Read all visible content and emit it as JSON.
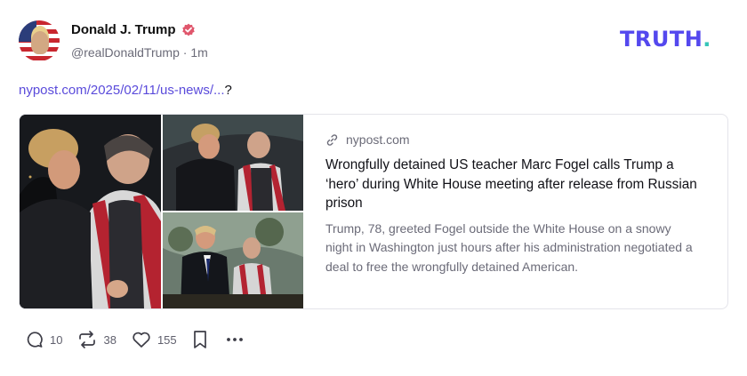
{
  "post": {
    "author_name": "Donald J. Trump",
    "handle": "@realDonaldTrump",
    "separator": "·",
    "time": "1m",
    "link_text": "nypost.com/2025/02/11/us-news/...",
    "link_suffix": "?"
  },
  "brand": {
    "logo_text": "TRUTH",
    "logo_dot": ".",
    "logo_color": "#5448ee",
    "dot_color": "#36c5b8",
    "verified_color": "#e0566c"
  },
  "card": {
    "domain": "nypost.com",
    "title": "Wrongfully detained US teacher Marc Fogel calls Trump a ‘hero’ during White House meeting after release from Russian prison",
    "description": "Trump, 78, greeted Fogel outside the White House on a snowy night in Washington just hours after his administration negotiated a deal to free the wrongfully detained American."
  },
  "actions": {
    "replies": "10",
    "retruths": "38",
    "likes": "155"
  },
  "icons": [
    "verified-icon",
    "link-icon",
    "reply-icon",
    "retruth-icon",
    "like-icon",
    "bookmark-icon",
    "more-icon"
  ]
}
